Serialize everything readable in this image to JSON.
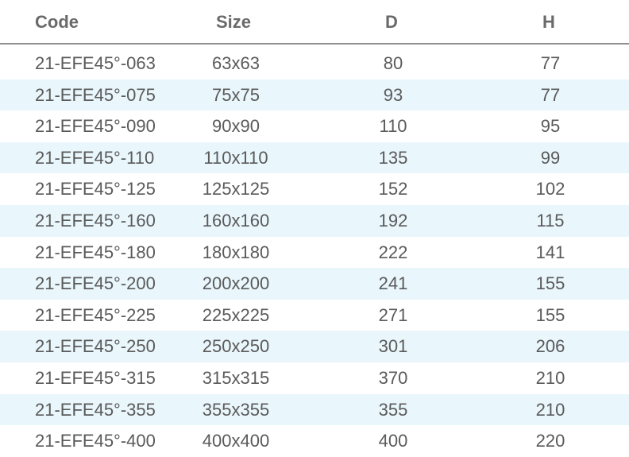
{
  "header": {
    "code": "Code",
    "size": "Size",
    "d": "D",
    "h": "H"
  },
  "rows": [
    {
      "code": "21-EFE45°-063",
      "size": "63x63",
      "d": "80",
      "h": "77"
    },
    {
      "code": "21-EFE45°-075",
      "size": "75x75",
      "d": "93",
      "h": "77"
    },
    {
      "code": "21-EFE45°-090",
      "size": "90x90",
      "d": "110",
      "h": "95"
    },
    {
      "code": "21-EFE45°-110",
      "size": "110x110",
      "d": "135",
      "h": "99"
    },
    {
      "code": "21-EFE45°-125",
      "size": "125x125",
      "d": "152",
      "h": "102"
    },
    {
      "code": "21-EFE45°-160",
      "size": "160x160",
      "d": "192",
      "h": "115"
    },
    {
      "code": "21-EFE45°-180",
      "size": "180x180",
      "d": "222",
      "h": "141"
    },
    {
      "code": "21-EFE45°-200",
      "size": "200x200",
      "d": "241",
      "h": "155"
    },
    {
      "code": "21-EFE45°-225",
      "size": "225x225",
      "d": "271",
      "h": "155"
    },
    {
      "code": "21-EFE45°-250",
      "size": "250x250",
      "d": "301",
      "h": "206"
    },
    {
      "code": "21-EFE45°-315",
      "size": "315x315",
      "d": "370",
      "h": "210"
    },
    {
      "code": "21-EFE45°-355",
      "size": "355x355",
      "d": "355",
      "h": "210"
    },
    {
      "code": "21-EFE45°-400",
      "size": "400x400",
      "d": "400",
      "h": "220"
    }
  ]
}
